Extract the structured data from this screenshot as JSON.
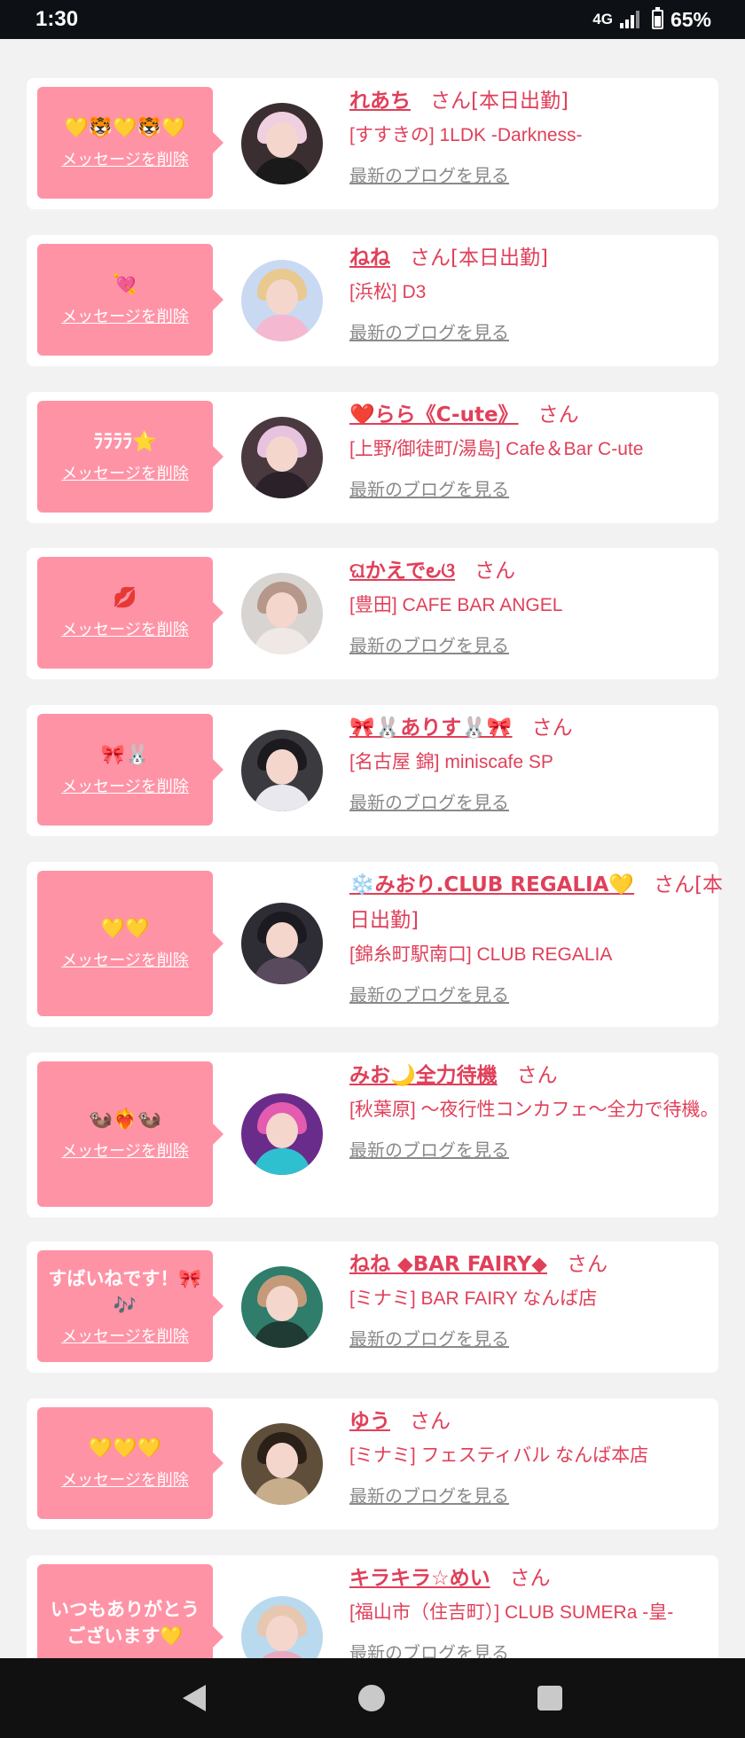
{
  "status_bar": {
    "time": "1:30",
    "network": "4G",
    "battery": "65%"
  },
  "delete_label": "メッセージを削除",
  "blog_label": "最新のブログを見る",
  "honorific": "さん",
  "cards": [
    {
      "message": "💛🐯💛🐯💛",
      "name": "れあち",
      "suffix": "さん[本日出勤]",
      "shop": "[すすきの] 1LDK -Darkness-"
    },
    {
      "message": "💘",
      "name": "ねね",
      "suffix": "さん[本日出勤]",
      "shop": "[浜松] D3"
    },
    {
      "message": "ﾗﾗﾗﾗ⭐️",
      "name": "❤️らら《C-ute》",
      "suffix": "さん",
      "shop": "[上野/御徒町/湯島] Cafe＆Bar C-ute"
    },
    {
      "message": "💋",
      "name": "ଘかえで౿ଓ",
      "suffix": "さん",
      "shop": "[豊田] CAFE BAR ANGEL"
    },
    {
      "message": "🎀🐰",
      "name": "🎀🐰ありす🐰🎀",
      "suffix": "さん",
      "shop": "[名古屋 錦] miniscafe SP"
    },
    {
      "message": "💛💛",
      "name": "❄️みおり.CLUB REGALIA💛",
      "suffix": "さん[本日出勤]",
      "shop": "[錦糸町駅南口] CLUB REGALIA"
    },
    {
      "message": "🦦❤️‍🔥🦦",
      "name": "みお🌙全力待機",
      "suffix": "さん",
      "shop": "[秋葉原] 〜夜行性コンカフェ〜全力で待機。"
    },
    {
      "message": "すばいねです！🎀🎶",
      "name": "ねね ◆BAR FAIRY◆",
      "suffix": "さん",
      "shop": "[ミナミ] BAR FAIRY なんば店"
    },
    {
      "message": "💛💛💛",
      "name": "ゆう",
      "suffix": "さん",
      "shop": "[ミナミ] フェスティバル なんば本店"
    },
    {
      "message": "いつもありがとうございます💛",
      "name": "キラキラ☆めい",
      "suffix": "さん",
      "shop": "[福山市（住吉町）] CLUB SUMERa -皇-"
    }
  ]
}
